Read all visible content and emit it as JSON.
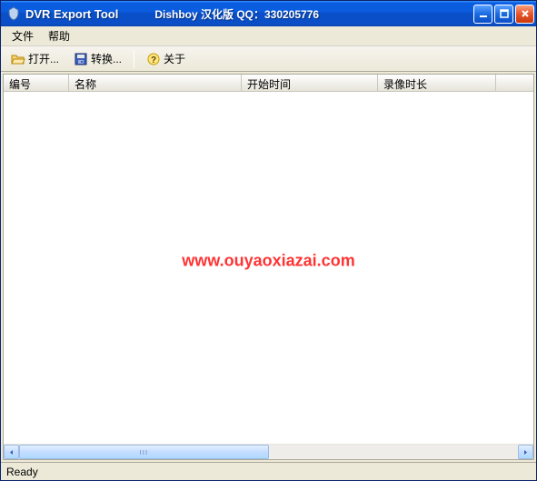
{
  "titlebar": {
    "app_title": "DVR Export Tool",
    "subtitle": "Dishboy 汉化版 QQ：330205776"
  },
  "menubar": {
    "file": "文件",
    "help": "帮助"
  },
  "toolbar": {
    "open": "打开...",
    "convert": "转换...",
    "about": "关于"
  },
  "columns": {
    "c0": "编号",
    "c1": "名称",
    "c2": "开始时间",
    "c3": "录像时长"
  },
  "watermark": "www.ouyaoxiazai.com",
  "statusbar": {
    "ready": "Ready"
  }
}
